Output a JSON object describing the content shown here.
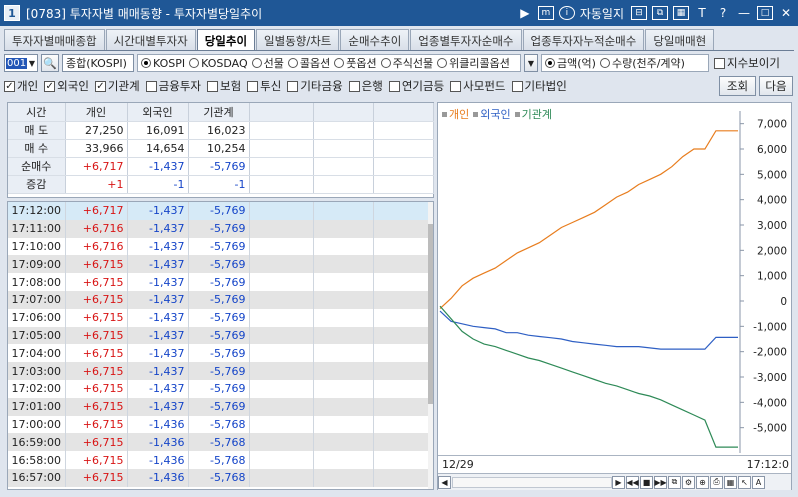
{
  "window": {
    "screen_code": "[0783]",
    "title": "투자자별 매매동향 - 투자자별당일추이",
    "auto_label": "자동일지",
    "tool_t": "T",
    "tool_q": "?"
  },
  "tabs": [
    {
      "label": "투자자별매매종합"
    },
    {
      "label": "시간대별투자자"
    },
    {
      "label": "당일추이"
    },
    {
      "label": "일별동향/차트"
    },
    {
      "label": "순매수추이"
    },
    {
      "label": "업종별투자자순매수"
    },
    {
      "label": "업종투자자누적순매수"
    },
    {
      "label": "당일매매현"
    }
  ],
  "options": {
    "code_value": "001",
    "market_combo": "종합(KOSPI)",
    "market_radios": [
      "KOSPI",
      "KOSDAQ",
      "선물",
      "콜옵션",
      "풋옵션",
      "주식선물",
      "위클리콜옵션"
    ],
    "unit_radios": [
      "금액(억)",
      "수량(천주/계약)"
    ],
    "index_check": "지수보이기"
  },
  "investor_checks": [
    {
      "label": "개인",
      "checked": true
    },
    {
      "label": "외국인",
      "checked": true
    },
    {
      "label": "기관계",
      "checked": true
    },
    {
      "label": "금융투자",
      "checked": false
    },
    {
      "label": "보험",
      "checked": false
    },
    {
      "label": "투신",
      "checked": false
    },
    {
      "label": "기타금융",
      "checked": false
    },
    {
      "label": "은행",
      "checked": false
    },
    {
      "label": "연기금등",
      "checked": false
    },
    {
      "label": "사모펀드",
      "checked": false
    },
    {
      "label": "기타법인",
      "checked": false
    }
  ],
  "buttons": {
    "query": "조회",
    "next": "다음"
  },
  "summary": {
    "headers": [
      "시간",
      "개인",
      "외국인",
      "기관계"
    ],
    "rows": [
      {
        "label": "매 도",
        "values": [
          "27,250",
          "16,091",
          "16,023"
        ]
      },
      {
        "label": "매 수",
        "values": [
          "33,966",
          "14,654",
          "10,254"
        ]
      },
      {
        "label": "순매수",
        "values": [
          "+6,717",
          "-1,437",
          "-5,769"
        ]
      },
      {
        "label": "증감",
        "values": [
          "+1",
          "-1",
          "-1"
        ]
      }
    ]
  },
  "timeseries": [
    {
      "time": "17:12:00",
      "v": [
        "+6,717",
        "-1,437",
        "-5,769"
      ]
    },
    {
      "time": "17:11:00",
      "v": [
        "+6,716",
        "-1,437",
        "-5,769"
      ]
    },
    {
      "time": "17:10:00",
      "v": [
        "+6,716",
        "-1,437",
        "-5,769"
      ]
    },
    {
      "time": "17:09:00",
      "v": [
        "+6,715",
        "-1,437",
        "-5,769"
      ]
    },
    {
      "time": "17:08:00",
      "v": [
        "+6,715",
        "-1,437",
        "-5,769"
      ]
    },
    {
      "time": "17:07:00",
      "v": [
        "+6,715",
        "-1,437",
        "-5,769"
      ]
    },
    {
      "time": "17:06:00",
      "v": [
        "+6,715",
        "-1,437",
        "-5,769"
      ]
    },
    {
      "time": "17:05:00",
      "v": [
        "+6,715",
        "-1,437",
        "-5,769"
      ]
    },
    {
      "time": "17:04:00",
      "v": [
        "+6,715",
        "-1,437",
        "-5,769"
      ]
    },
    {
      "time": "17:03:00",
      "v": [
        "+6,715",
        "-1,437",
        "-5,769"
      ]
    },
    {
      "time": "17:02:00",
      "v": [
        "+6,715",
        "-1,437",
        "-5,769"
      ]
    },
    {
      "time": "17:01:00",
      "v": [
        "+6,715",
        "-1,437",
        "-5,769"
      ]
    },
    {
      "time": "17:00:00",
      "v": [
        "+6,715",
        "-1,436",
        "-5,768"
      ]
    },
    {
      "time": "16:59:00",
      "v": [
        "+6,715",
        "-1,436",
        "-5,768"
      ]
    },
    {
      "time": "16:58:00",
      "v": [
        "+6,715",
        "-1,436",
        "-5,768"
      ]
    },
    {
      "time": "16:57:00",
      "v": [
        "+6,715",
        "-1,436",
        "-5,768"
      ]
    }
  ],
  "chart_data": {
    "type": "line",
    "x_start_label": "12/29",
    "x_end_label": "17:12:0",
    "ylim": [
      -6000,
      7500
    ],
    "y_ticks": [
      7000,
      6000,
      5000,
      4000,
      3000,
      2000,
      1000,
      0,
      -1000,
      -2000,
      -3000,
      -4000,
      -5000
    ],
    "y_tick_labels": [
      "7,000",
      "6,000",
      "5,000",
      "4,000",
      "3,000",
      "2,000",
      "1,000",
      "0",
      "-1,000",
      "-2,000",
      "-3,000",
      "-4,000",
      "-5,000"
    ],
    "series": [
      {
        "name": "개인",
        "color": "#e87d1e",
        "values": [
          -300,
          100,
          600,
          900,
          1100,
          1300,
          1600,
          1900,
          2100,
          2300,
          2600,
          2900,
          3100,
          3300,
          3500,
          3800,
          4100,
          4300,
          4600,
          4800,
          5000,
          5300,
          5700,
          6000,
          6000,
          6717,
          6717,
          6717
        ]
      },
      {
        "name": "외국인",
        "color": "#2e5fc4",
        "values": [
          -400,
          -800,
          -900,
          -1000,
          -1050,
          -1100,
          -1250,
          -1250,
          -1350,
          -1400,
          -1450,
          -1500,
          -1600,
          -1650,
          -1700,
          -1750,
          -1800,
          -1800,
          -1800,
          -1850,
          -1900,
          -1900,
          -1900,
          -1900,
          -1900,
          -1437,
          -1437,
          -1437
        ]
      },
      {
        "name": "기관계",
        "color": "#2e8a57",
        "values": [
          -200,
          -700,
          -1200,
          -1500,
          -1700,
          -1800,
          -1950,
          -2100,
          -2250,
          -2350,
          -2500,
          -2650,
          -2800,
          -2950,
          -3100,
          -3250,
          -3350,
          -3500,
          -3650,
          -3750,
          -3900,
          -4100,
          -4300,
          -4500,
          -4700,
          -5769,
          -5769,
          -5769
        ]
      }
    ]
  }
}
